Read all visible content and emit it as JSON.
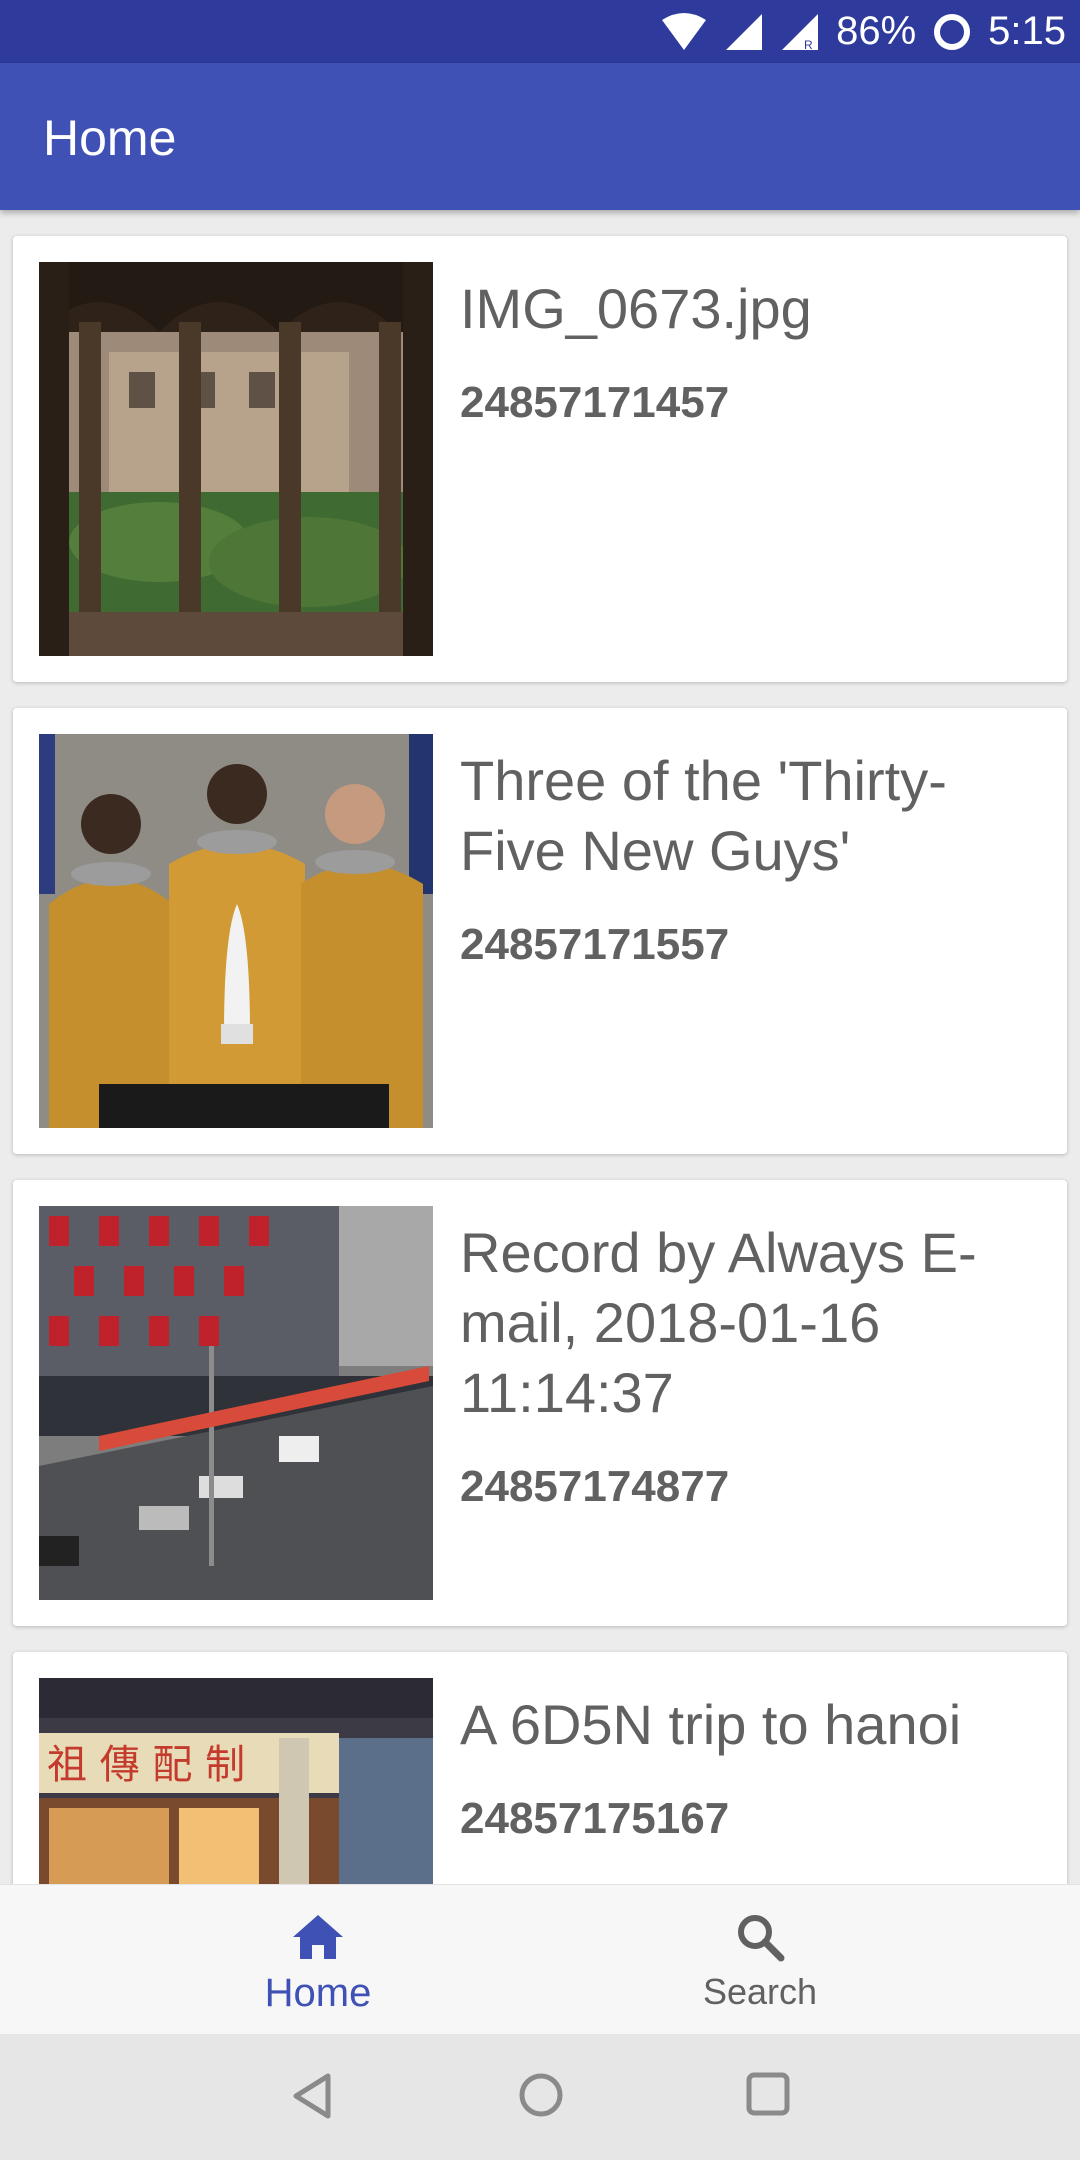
{
  "status_bar": {
    "battery_percent": "86%",
    "time": "5:15",
    "icons": [
      "wifi-icon",
      "signal-icon",
      "signal-roaming-icon",
      "battery-icon"
    ]
  },
  "app_bar": {
    "title": "Home"
  },
  "feed": {
    "items": [
      {
        "title": "IMG_0673.jpg",
        "id": "24857171457",
        "thumbnail": "cloister-photo"
      },
      {
        "title": "Three of the 'Thirty-Five New Guys'",
        "id": "24857171557",
        "thumbnail": "astronauts-photo"
      },
      {
        "title": "Record by Always E-mail, 2018-01-16 11:14:37",
        "id": "24857174877",
        "thumbnail": "street-photo"
      },
      {
        "title": "A 6D5N trip to hanoi",
        "id": "24857175167",
        "thumbnail": "storefront-photo"
      }
    ]
  },
  "bottom_nav": {
    "items": [
      {
        "label": "Home",
        "icon": "home-icon",
        "active": true
      },
      {
        "label": "Search",
        "icon": "search-icon",
        "active": false
      }
    ],
    "active_color": "#3f51b5",
    "inactive_color": "#616161"
  },
  "system_nav": {
    "icons": [
      "back-icon",
      "home-circle-icon",
      "recents-icon"
    ]
  },
  "colors": {
    "primary": "#3f51b5",
    "primary_dark": "#2f3b9c",
    "text_secondary": "#616161"
  }
}
